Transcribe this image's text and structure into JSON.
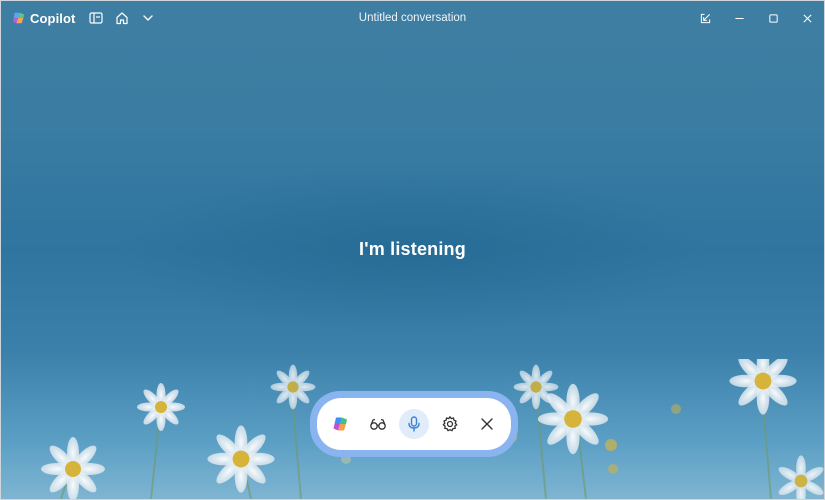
{
  "app": {
    "name": "Copilot",
    "window_title": "Untitled conversation"
  },
  "titlebar": {
    "left_icons": [
      "sidebar-icon",
      "home-icon",
      "chevron-down-icon"
    ],
    "right_icons": [
      "new-window-icon",
      "minimize-icon",
      "maximize-icon",
      "close-icon"
    ]
  },
  "main": {
    "status_text": "I'm listening"
  },
  "voice_toolbar": {
    "buttons": [
      "copilot-logo-icon",
      "glasses-icon",
      "microphone-icon",
      "settings-icon",
      "close-icon"
    ],
    "active": "microphone-icon"
  },
  "colors": {
    "background_top": "#3f7ea3",
    "background_mid": "#2f75a0",
    "toolbar_ring": "#8ab4ef",
    "mic_active": "#3b82d6"
  }
}
